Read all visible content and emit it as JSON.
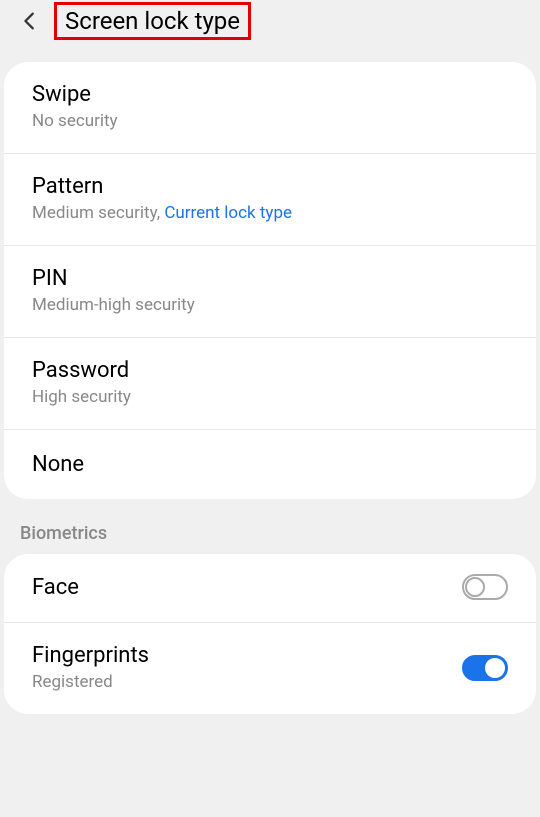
{
  "header": {
    "title": "Screen lock type"
  },
  "lockTypes": {
    "swipe": {
      "title": "Swipe",
      "subtitle": "No security"
    },
    "pattern": {
      "title": "Pattern",
      "subtitlePrefix": "Medium security, ",
      "subtitleLink": "Current lock type"
    },
    "pin": {
      "title": "PIN",
      "subtitle": "Medium-high security"
    },
    "password": {
      "title": "Password",
      "subtitle": "High security"
    },
    "none": {
      "title": "None"
    }
  },
  "biometrics": {
    "sectionLabel": "Biometrics",
    "face": {
      "title": "Face",
      "enabled": false
    },
    "fingerprints": {
      "title": "Fingerprints",
      "subtitle": "Registered",
      "enabled": true
    }
  }
}
